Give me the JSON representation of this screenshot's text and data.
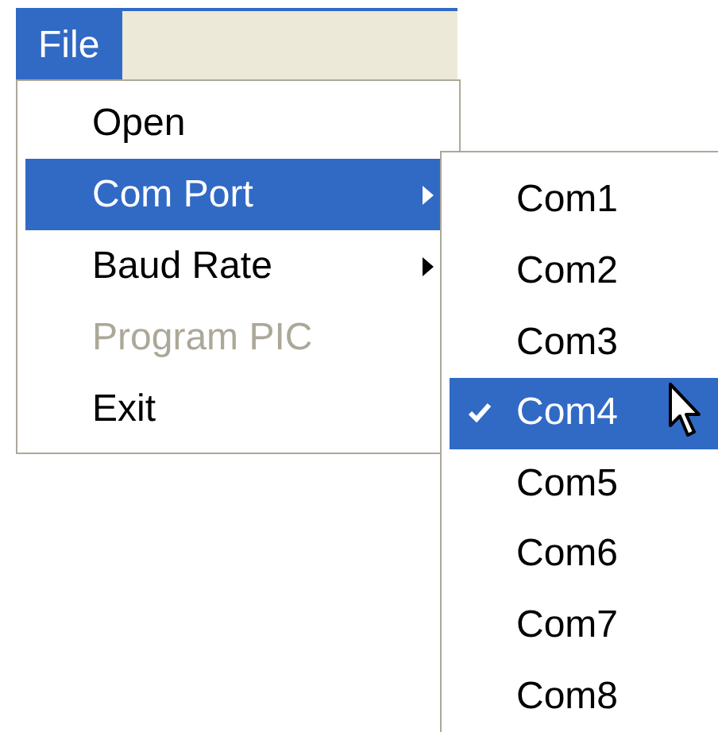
{
  "menubar": [
    {
      "label": "File",
      "selected": true
    }
  ],
  "menu": {
    "items": [
      {
        "label": "Open",
        "kind": "item",
        "selected": false,
        "disabled": false
      },
      {
        "label": "Com Port",
        "kind": "submenu",
        "selected": true,
        "disabled": false,
        "children": [
          {
            "label": "Com1",
            "checked": false,
            "selected": false
          },
          {
            "label": "Com2",
            "checked": false,
            "selected": false
          },
          {
            "label": "Com3",
            "checked": false,
            "selected": false
          },
          {
            "label": "Com4",
            "checked": true,
            "selected": true
          },
          {
            "label": "Com5",
            "checked": false,
            "selected": false
          },
          {
            "label": "Com6",
            "checked": false,
            "selected": false
          },
          {
            "label": "Com7",
            "checked": false,
            "selected": false
          },
          {
            "label": "Com8",
            "checked": false,
            "selected": false
          }
        ]
      },
      {
        "label": "Baud Rate",
        "kind": "submenu",
        "selected": false,
        "disabled": false
      },
      {
        "label": "Program PIC",
        "kind": "item",
        "selected": false,
        "disabled": true
      },
      {
        "label": "Exit",
        "kind": "item",
        "selected": false,
        "disabled": false
      }
    ]
  }
}
